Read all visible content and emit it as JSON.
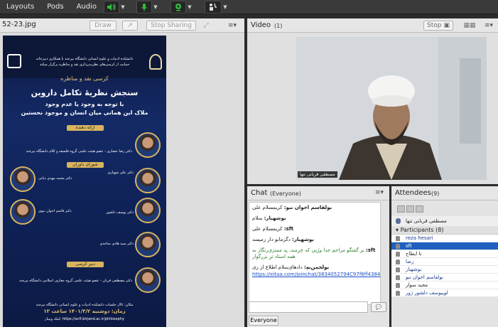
{
  "menu": {
    "items": [
      "Layouts",
      "Pods",
      "Audio"
    ]
  },
  "share": {
    "title": "52-23.jpg",
    "draw_label": "Draw",
    "stop_sharing_label": "Stop Sharing",
    "poster": {
      "org_line": "دانشکده ادبیات و علوم انسانی دانشگاه بیرجند با همکاری دبیرخانه",
      "org_line2": "حمایت از کرسی‌های نظریه‌پردازی نقد و مناظره برگزار میکند",
      "series_title": "کرسی نقد و مناظره",
      "main_title": "سنجش نظریهٔ تکامل داروین",
      "subtitle1": "با توجه به وجود یا عدم وجود",
      "subtitle2": "ملاک این همانی میان انسان و موجود نخستین",
      "presenter_banner": "ارائه دهنده",
      "presenter": "دکتر رضا حصاری - عضو هیئت علمی گروه فلسفه و کلام دانشگاه بیرجند",
      "judges_banner": "شورای داوران",
      "judge1": "دکتر علی شهبازی",
      "judge2": "دکتر محمد مهدی دیانی",
      "judge3": "دکتر یوسف دلشور",
      "judge4": "دکتر قاسم اخوان نبوی",
      "judge5": "دکتر سید هادی ساجدی",
      "secretary_banner": "دبیر کرسی",
      "secretary": "دکتر مصطفی قربان - عضو هیئت علمی گروه معارف اسلامی دانشگاه بیرجند",
      "place": "مکان: تالار جلسات دانشکده ادبیات و علوم انسانی دانشگاه بیرجند",
      "time": "زمان: دوشنبه ۱۴۰۱/۳/۲ ساعت ۱۳",
      "webinar": "لینک وبینار:",
      "url": "https://acfi.birjand.ac.ir/philosophy"
    }
  },
  "video": {
    "title": "Video",
    "count": "(1)",
    "stop_label": "Stop",
    "nametag": "مصطفی قربانی تنها"
  },
  "chat": {
    "title": "Chat",
    "scope": "(Everyone)",
    "scope_button": "Everyone",
    "messages": [
      {
        "name": "بولقاسم اخوان نبو:",
        "text": "کریمسلام علی"
      },
      {
        "name": "بوشهبار:",
        "text": "سلام"
      },
      {
        "name": "sft:",
        "text": "کریمسلام علی"
      },
      {
        "name": "بوشهبار:",
        "text": "دگرمابو دار زمیسد"
      },
      {
        "name": "sft:",
        "text": "بر گفتگو مزاحم جدا وزَنِی که خِرِمند، یِد ممتزی‌رنگار به همه استاد ترِ بزرگوار"
      },
      {
        "name": "بولجمن‌بهِ:",
        "text": "دادهای‌سلام اطلاع از ری"
      }
    ],
    "link": "https://eitaa.com/joinchat/3834052794C97f6ff4384"
  },
  "attendees": {
    "title": "Attendees",
    "count": "(9)",
    "host": "مصطفی قربانی تنها",
    "participants_label": "Participants",
    "participants_count": "(8)",
    "list": [
      "reza hesari",
      "sft",
      "نا ایطاح",
      "رضا",
      "بوشهبار",
      "بولقاسم اخوان نبو",
      "مجید سوار",
      "لوییوسف دلشور ژور"
    ]
  }
}
